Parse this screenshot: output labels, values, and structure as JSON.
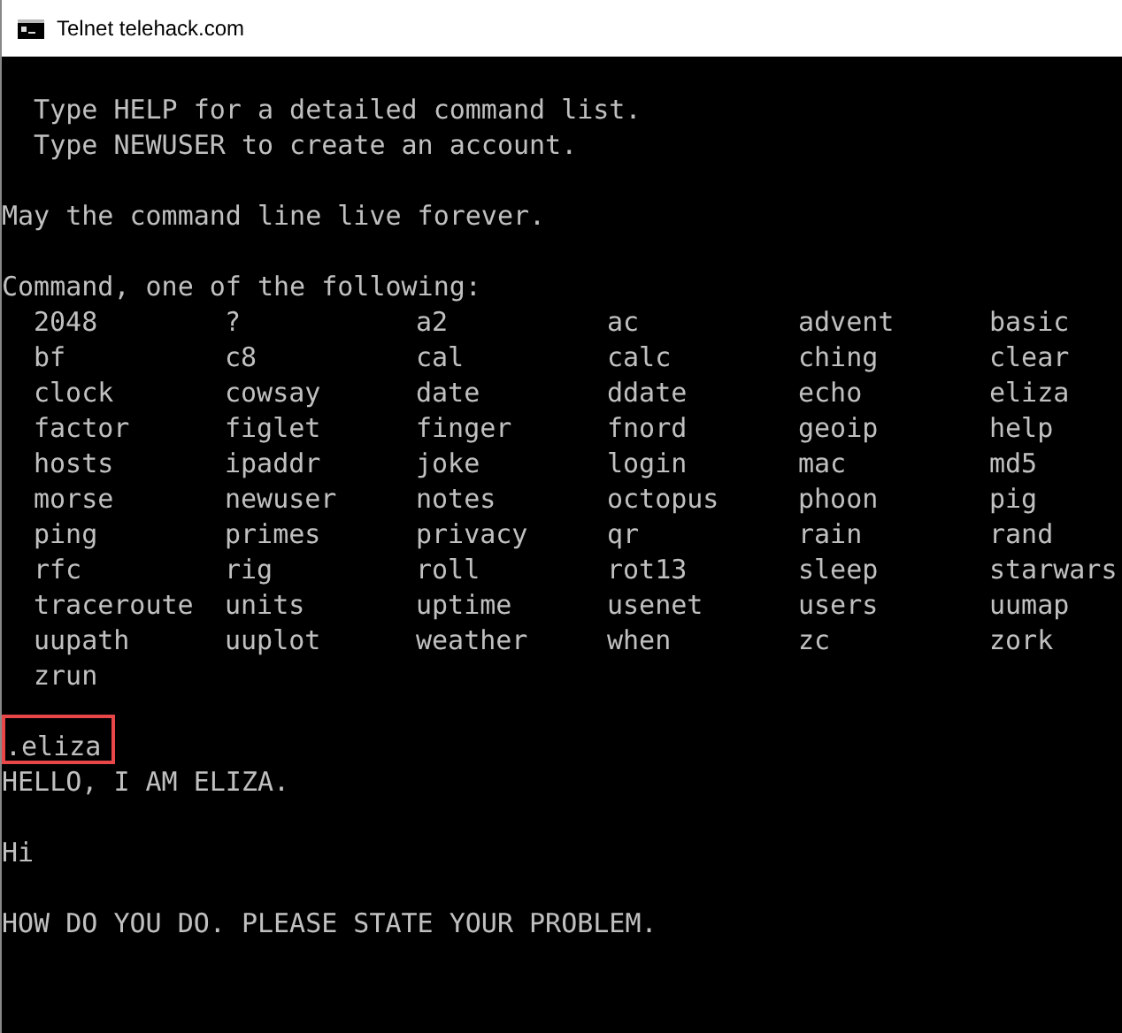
{
  "window": {
    "title": "Telnet telehack.com"
  },
  "terminal": {
    "blocks": [
      {
        "lines": [
          {
            "text": "  Type HELP for a detailed command list.",
            "highlighted": false
          },
          {
            "text": "  Type NEWUSER to create an account.",
            "highlighted": false
          }
        ]
      },
      {
        "lines": [
          {
            "text": "May the command line live forever.",
            "highlighted": false
          }
        ]
      },
      {
        "lines": [
          {
            "text": "Command, one of the following:",
            "highlighted": false
          }
        ],
        "commands": [
          "2048",
          "?",
          "a2",
          "ac",
          "advent",
          "basic",
          "bf",
          "c8",
          "cal",
          "calc",
          "ching",
          "clear",
          "clock",
          "cowsay",
          "date",
          "ddate",
          "echo",
          "eliza",
          "factor",
          "figlet",
          "finger",
          "fnord",
          "geoip",
          "help",
          "hosts",
          "ipaddr",
          "joke",
          "login",
          "mac",
          "md5",
          "morse",
          "newuser",
          "notes",
          "octopus",
          "phoon",
          "pig",
          "ping",
          "primes",
          "privacy",
          "qr",
          "rain",
          "rand",
          "rfc",
          "rig",
          "roll",
          "rot13",
          "sleep",
          "starwars",
          "traceroute",
          "units",
          "uptime",
          "usenet",
          "users",
          "uumap",
          "uupath",
          "uuplot",
          "weather",
          "when",
          "zc",
          "zork",
          "zrun"
        ]
      },
      {
        "lines": [
          {
            "text": ".eliza",
            "highlighted": true
          },
          {
            "text": "HELLO, I AM ELIZA.",
            "highlighted": false
          }
        ]
      },
      {
        "lines": [
          {
            "text": "Hi",
            "highlighted": false
          }
        ]
      },
      {
        "lines": [
          {
            "text": "HOW DO YOU DO. PLEASE STATE YOUR PROBLEM.",
            "highlighted": false
          }
        ]
      }
    ]
  }
}
